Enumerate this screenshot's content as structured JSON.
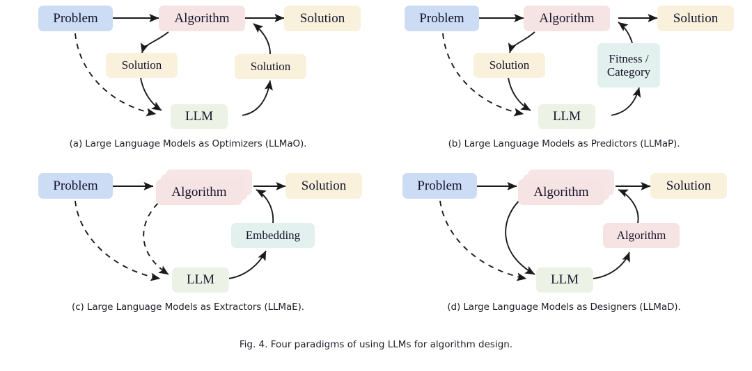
{
  "figure": {
    "caption": "Fig. 4.  Four paradigms of using LLMs for algorithm design.",
    "colors": {
      "problem": "#ccdcf4",
      "algorithm": "#f6e3e4",
      "solution": "#faf1dc",
      "llm": "#ecf2e5",
      "feedback": "#e2f0ee",
      "arrow": "#1a1a1a"
    }
  },
  "panels": [
    {
      "id": "a",
      "caption": "(a) Large Language Models as Optimizers (LLMaO).",
      "nodes": {
        "problem": "Problem",
        "algorithm": "Algorithm",
        "solution_right": "Solution",
        "solution_mid_left": "Solution",
        "solution_mid_right": "Solution",
        "llm": "LLM"
      }
    },
    {
      "id": "b",
      "caption": "(b) Large Language Models as Predictors (LLMaP).",
      "nodes": {
        "problem": "Problem",
        "algorithm": "Algorithm",
        "solution_right": "Solution",
        "solution_mid_left": "Solution",
        "feedback": "Fitness /\nCategory",
        "llm": "LLM"
      }
    },
    {
      "id": "c",
      "caption": "(c) Large Language Models as Extractors (LLMaE).",
      "nodes": {
        "problem": "Problem",
        "algorithm": "Algorithm",
        "solution_right": "Solution",
        "embedding": "Embedding",
        "llm": "LLM"
      }
    },
    {
      "id": "d",
      "caption": "(d) Large Language Models as Designers (LLMaD).",
      "nodes": {
        "problem": "Problem",
        "algorithm": "Algorithm",
        "solution_right": "Solution",
        "algorithm_small": "Algorithm",
        "llm": "LLM"
      }
    }
  ]
}
